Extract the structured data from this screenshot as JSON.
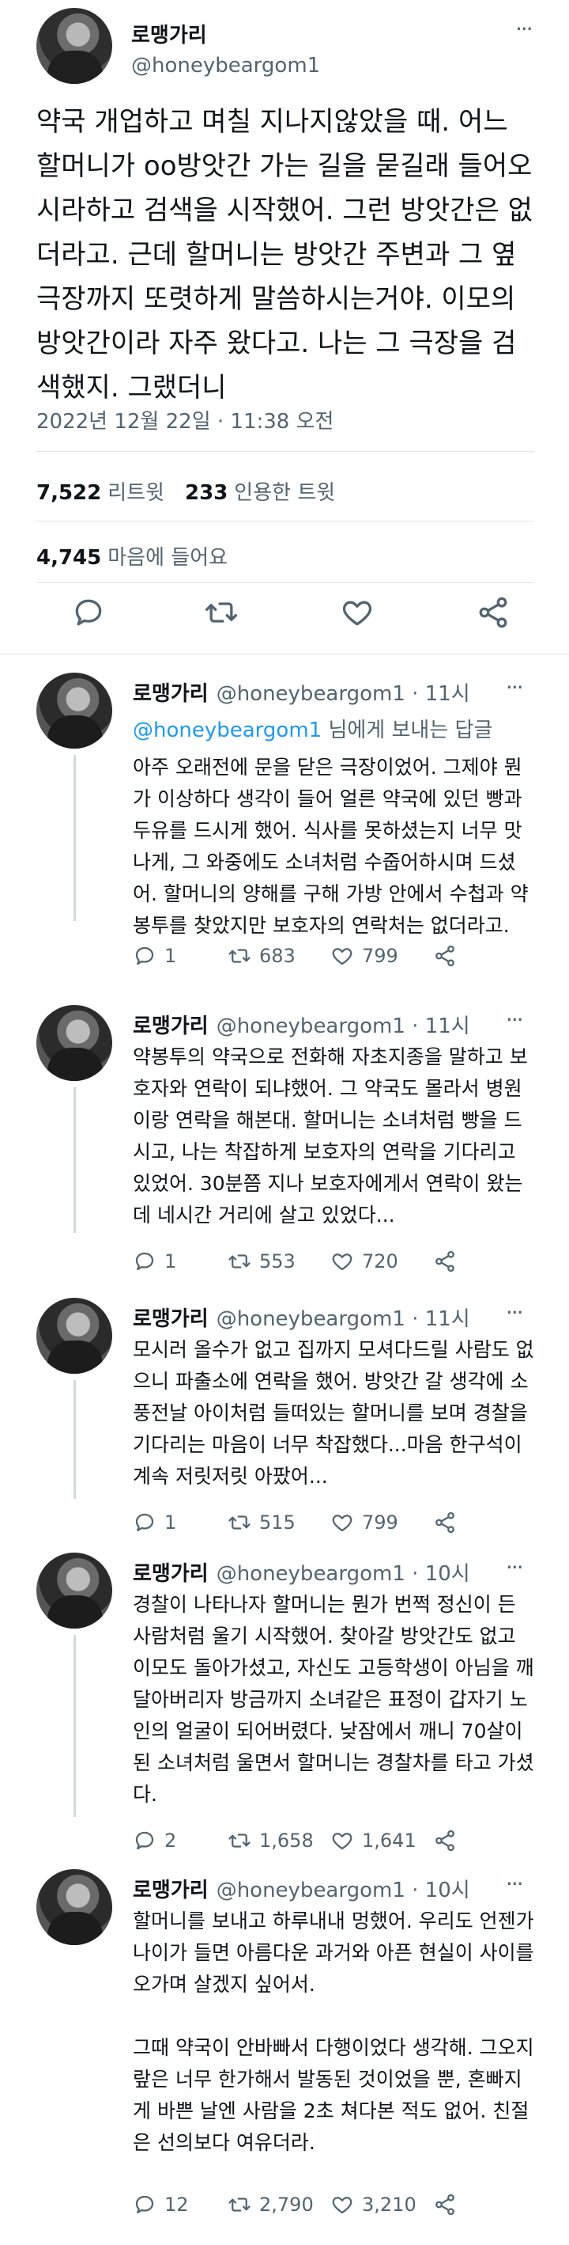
{
  "main": {
    "name": "로맹가리",
    "handle": "@honeybeargom1",
    "more_icon": "more-horizontal-icon",
    "body": "약국 개업하고 며칠 지나지않았을 때. 어느 할머니가 oo방앗간 가는 길을 묻길래 들어오시라하고 검색을 시작했어. 그런 방앗간은 없더라고. 근데 할머니는 방앗간 주변과 그 옆 극장까지 또렷하게 말씀하시는거야. 이모의 방앗간이라 자주 왔다고. 나는 그 극장을 검색했지. 그랬더니",
    "timestamp": "2022년 12월 22일 · 11:38 오전",
    "retweets_count": "7,522",
    "retweets_label": "리트윗",
    "quotes_count": "233",
    "quotes_label": "인용한 트윗",
    "likes_count": "4,745",
    "likes_label": "마음에 들어요",
    "actions": [
      "reply-icon",
      "retweet-icon",
      "like-icon",
      "share-icon"
    ]
  },
  "replies": [
    {
      "name": "로맹가리",
      "handle": "@honeybeargom1",
      "dot": "·",
      "time": "11시",
      "replying_mention": "@honeybeargom1",
      "replying_suffix": "님에게 보내는 답글",
      "body": "아주 오래전에 문을 닫은 극장이었어. 그제야 뭔가 이상하다 생각이 들어 얼른 약국에 있던 빵과 두유를 드시게 했어. 식사를 못하셨는지 너무 맛나게, 그 와중에도 소녀처럼 수줍어하시며 드셨어. 할머니의 양해를 구해 가방 안에서 수첩과 약봉투를 찾았지만 보호자의 연락처는 없더라고.",
      "replies": "1",
      "retweets": "683",
      "likes": "799"
    },
    {
      "name": "로맹가리",
      "handle": "@honeybeargom1",
      "dot": "·",
      "time": "11시",
      "body": "약봉투의 약국으로 전화해 자초지종을 말하고 보호자와 연락이 되냐했어. 그 약국도 몰라서 병원이랑 연락을 해본대. 할머니는 소녀처럼 빵을 드시고, 나는 착잡하게 보호자의 연락을 기다리고 있었어. 30분쯤 지나 보호자에게서 연락이 왔는데 네시간 거리에 살고 있었다...",
      "replies": "1",
      "retweets": "553",
      "likes": "720"
    },
    {
      "name": "로맹가리",
      "handle": "@honeybeargom1",
      "dot": "·",
      "time": "11시",
      "body": "모시러 올수가 없고 집까지 모셔다드릴 사람도 없으니 파출소에 연락을 했어. 방앗간 갈 생각에 소풍전날 아이처럼 들떠있는 할머니를 보며 경찰을 기다리는 마음이 너무 착잡했다...마음 한구석이 계속 저릿저릿 아팠어...",
      "replies": "1",
      "retweets": "515",
      "likes": "799"
    },
    {
      "name": "로맹가리",
      "handle": "@honeybeargom1",
      "dot": "·",
      "time": "10시",
      "body": "경찰이 나타나자 할머니는 뭔가 번쩍 정신이 든 사람처럼 울기 시작했어. 찾아갈 방앗간도 없고 이모도 돌아가셨고, 자신도 고등학생이 아님을 깨달아버리자 방금까지 소녀같은 표정이 갑자기 노인의 얼굴이 되어버렸다. 낮잠에서 깨니 70살이 된 소녀처럼 울면서 할머니는 경찰차를 타고 가셨다.",
      "replies": "2",
      "retweets": "1,658",
      "likes": "1,641"
    },
    {
      "name": "로맹가리",
      "handle": "@honeybeargom1",
      "dot": "·",
      "time": "10시",
      "body": "할머니를 보내고 하루내내 멍했어. 우리도 언젠가 나이가 들면 아름다운 과거와 아픈 현실이 사이를 오가며 살겠지 싶어서.\n\n그때 약국이 안바빠서 다행이었다 생각해. 그오지랖은 너무 한가해서 발동된 것이었을 뿐, 혼빠지게 바쁜 날엔 사람을 2초 쳐다본 적도 없어. 친절은 선의보다 여유더라.",
      "replies": "12",
      "retweets": "2,790",
      "likes": "3,210"
    }
  ]
}
